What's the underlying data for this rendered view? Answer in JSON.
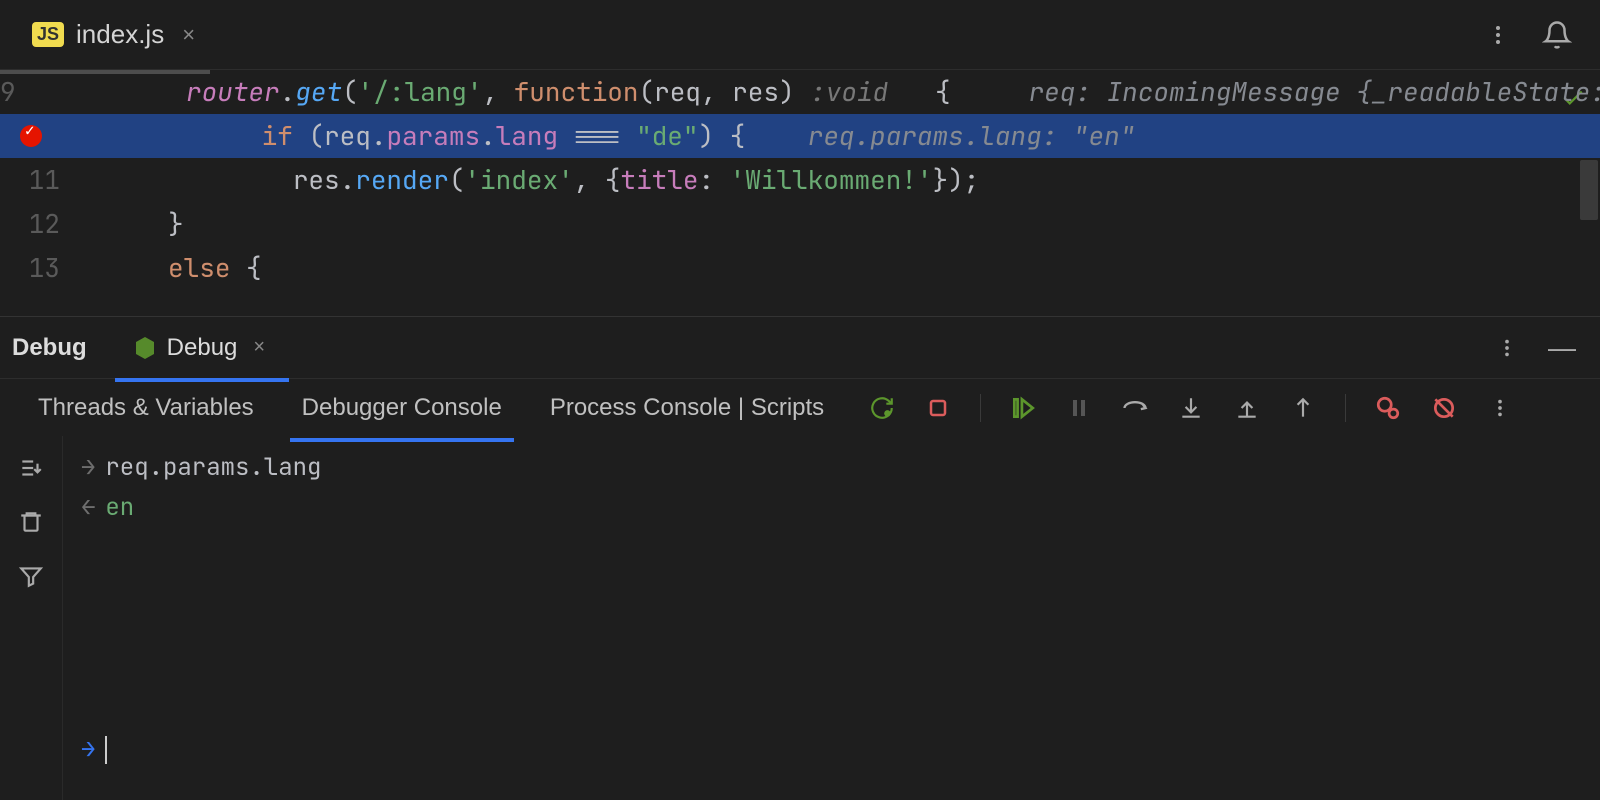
{
  "tabs": {
    "file_badge": "JS",
    "file_name": "index.js"
  },
  "editor": {
    "lines": {
      "l9": {
        "num": "9",
        "var_router": "router",
        "dot1": ".",
        "fn_get": "get",
        "open": "(",
        "str_path": "'/:lang'",
        "comma": ", ",
        "kw_function": "function",
        "open2": "(",
        "p_req": "req",
        "comma2": ", ",
        "p_res": "res",
        "close": ")",
        "hint_void": " :void ",
        "brace": "  {",
        "inline": "req: IncomingMessage {_readableState: "
      },
      "l10": {
        "num": "",
        "kw_if": "if",
        "open": " (",
        "var_req": "req",
        "dot": ".",
        "prop_params": "params",
        "dot2": ".",
        "prop_lang": "lang",
        "op": " === ",
        "str_de": "\"de\"",
        "close": ")",
        "brace": " {",
        "inline": "req.params.lang: \"en\""
      },
      "l11": {
        "num": "11",
        "var_res": "res",
        "dot": ".",
        "fn_render": "render",
        "open": "(",
        "str_index": "'index'",
        "comma": ", ",
        "brace_o": "{",
        "prop_title": "title",
        "colon": ": ",
        "str_willkommen": "'Willkommen!'",
        "brace_c": "}",
        "close": ");"
      },
      "l12": {
        "num": "12",
        "brace": "}"
      },
      "l13": {
        "num": "13",
        "kw_else": "else",
        "brace": " {"
      }
    }
  },
  "debug": {
    "title": "Debug",
    "run_config": "Debug",
    "sub_tabs": {
      "threads": "Threads & Variables",
      "debugger": "Debugger Console",
      "process": "Process Console",
      "scripts": "Scripts"
    }
  },
  "console": {
    "input": "req.params.lang",
    "output": "en"
  },
  "icons": {
    "more": "more-vert",
    "bell": "bell",
    "close": "×",
    "minimize": "—"
  }
}
